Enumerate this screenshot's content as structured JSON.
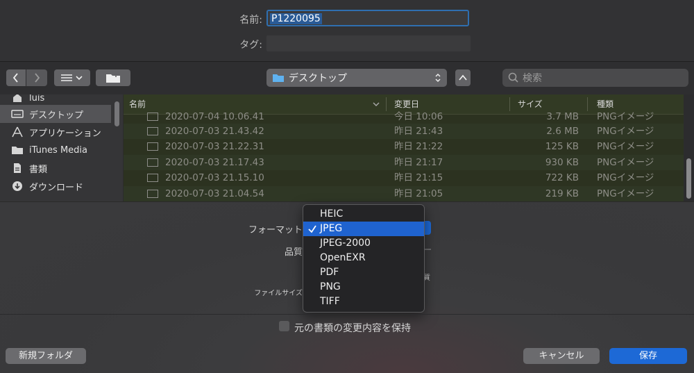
{
  "window": {
    "name_label": "名前:",
    "name_value": "P1220095",
    "tag_label": "タグ:"
  },
  "toolbar": {
    "location": "デスクトップ",
    "search_placeholder": "検索"
  },
  "sidebar": {
    "items": [
      {
        "label": "luis",
        "icon": "home-icon"
      },
      {
        "label": "デスクトップ",
        "icon": "desktop-icon",
        "selected": true
      },
      {
        "label": "アプリケーション",
        "icon": "applications-icon"
      },
      {
        "label": "iTunes Media",
        "icon": "folder-icon"
      },
      {
        "label": "書類",
        "icon": "documents-icon"
      },
      {
        "label": "ダウンロード",
        "icon": "downloads-icon"
      }
    ]
  },
  "file_list": {
    "columns": {
      "name": "名前",
      "modified": "変更日",
      "size": "サイズ",
      "kind": "種類"
    },
    "rows": [
      {
        "name": "2020-07-04 10.06.41",
        "modified": "今日 10:06",
        "size": "3.7 MB",
        "kind": "PNGイメージ"
      },
      {
        "name": "2020-07-03 21.43.42",
        "modified": "昨日 21:43",
        "size": "2.6 MB",
        "kind": "PNGイメージ"
      },
      {
        "name": "2020-07-03 21.22.31",
        "modified": "昨日 21:22",
        "size": "125 KB",
        "kind": "PNGイメージ"
      },
      {
        "name": "2020-07-03 21.17.43",
        "modified": "昨日 21:17",
        "size": "930 KB",
        "kind": "PNGイメージ"
      },
      {
        "name": "2020-07-03 21.15.10",
        "modified": "昨日 21:15",
        "size": "722 KB",
        "kind": "PNGイメージ"
      },
      {
        "name": "2020-07-03 21.04.54",
        "modified": "昨日 21:05",
        "size": "219 KB",
        "kind": "PNGイメージ"
      }
    ]
  },
  "options": {
    "format_label": "フォーマット",
    "quality_label": "品質",
    "filesize_label": "ファイルサイズ",
    "quality_suffix": "質",
    "format_menu": [
      "HEIC",
      "JPEG",
      "JPEG-2000",
      "OpenEXR",
      "PDF",
      "PNG",
      "TIFF"
    ],
    "selected_format": "JPEG",
    "keep_changes_label": "元の書類の変更内容を保持"
  },
  "buttons": {
    "new_folder": "新規フォルダ",
    "cancel": "キャンセル",
    "save": "保存"
  },
  "colors": {
    "accent": "#1d69d6",
    "selection": "#1f63cf",
    "list_tint": "#2c3220"
  }
}
